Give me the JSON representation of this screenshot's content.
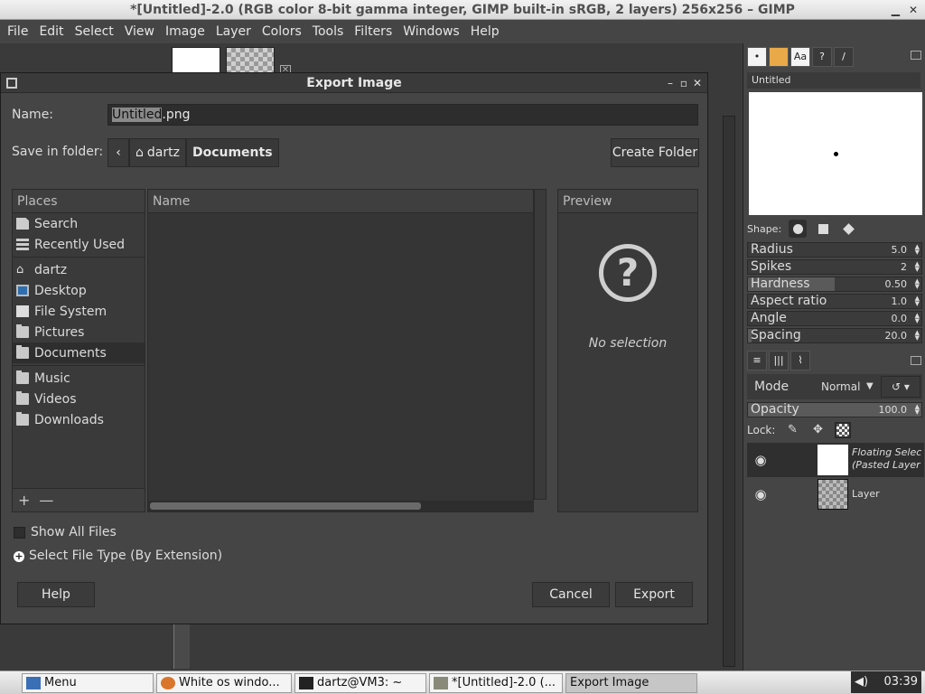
{
  "window": {
    "title": "*[Untitled]-2.0 (RGB color 8-bit gamma integer, GIMP built-in sRGB, 2 layers) 256x256 – GIMP"
  },
  "menubar": [
    "File",
    "Edit",
    "Select",
    "View",
    "Image",
    "Layer",
    "Colors",
    "Tools",
    "Filters",
    "Windows",
    "Help"
  ],
  "brushes": {
    "name": "Untitled",
    "shape_label": "Shape:",
    "params": [
      {
        "label": "Radius",
        "value": "5.0",
        "fraction": 0.0
      },
      {
        "label": "Spikes",
        "value": "2",
        "fraction": 0.0
      },
      {
        "label": "Hardness",
        "value": "0.50",
        "fraction": 0.5
      },
      {
        "label": "Aspect ratio",
        "value": "1.0",
        "fraction": 0.0
      },
      {
        "label": "Angle",
        "value": "0.0",
        "fraction": 0.0
      },
      {
        "label": "Spacing",
        "value": "20.0",
        "fraction": 0.02
      }
    ]
  },
  "layers": {
    "mode_label": "Mode",
    "mode_value": "Normal",
    "opacity_label": "Opacity",
    "opacity_value": "100.0",
    "lock_label": "Lock:",
    "items": [
      {
        "name_line1": "Floating Selec",
        "name_line2": "(Pasted Layer"
      },
      {
        "name_line1": "Layer",
        "name_line2": ""
      }
    ]
  },
  "dialog": {
    "title": "Export Image",
    "name_label": "Name:",
    "name_value_selected": "Untitled",
    "name_value_rest": ".png",
    "folder_label": "Save in folder:",
    "path": [
      "dartz",
      "Documents"
    ],
    "create_folder": "Create Folder",
    "places_header": "Places",
    "places": [
      {
        "label": "Search",
        "icon": "search-icon"
      },
      {
        "label": "Recently Used",
        "icon": "recent-icon"
      },
      {
        "label": "dartz",
        "icon": "home-icon"
      },
      {
        "label": "Desktop",
        "icon": "desktop-icon"
      },
      {
        "label": "File System",
        "icon": "filesystem-icon"
      },
      {
        "label": "Pictures",
        "icon": "folder-icon"
      },
      {
        "label": "Documents",
        "icon": "folder-icon"
      },
      {
        "label": "Music",
        "icon": "folder-icon"
      },
      {
        "label": "Videos",
        "icon": "folder-icon"
      },
      {
        "label": "Downloads",
        "icon": "folder-icon"
      }
    ],
    "files_header": "Name",
    "preview_header": "Preview",
    "no_selection": "No selection",
    "show_all_files": "Show All Files",
    "select_file_type": "Select File Type (By Extension)",
    "help": "Help",
    "cancel": "Cancel",
    "export": "Export"
  },
  "taskbar": {
    "menu": "Menu",
    "tasks": [
      "White os windo...",
      "dartz@VM3: ~",
      "*[Untitled]-2.0 (...",
      "Export Image"
    ],
    "clock": "03:39"
  },
  "colors": {
    "accent_selected": "#2e2e2e",
    "desktop_icon": "#2e6fae"
  }
}
